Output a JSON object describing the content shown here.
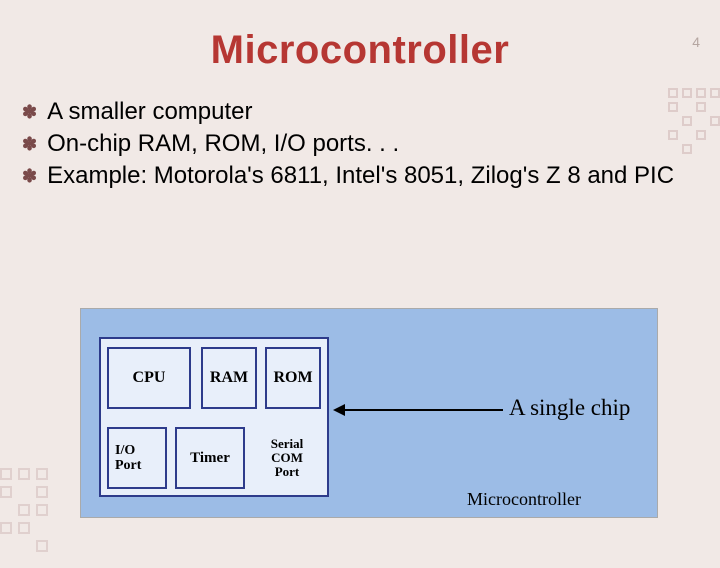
{
  "page_number": "4",
  "title": "Microcontroller",
  "bullets": [
    "A smaller computer",
    "On-chip RAM, ROM, I/O ports. . .",
    "Example: Motorola's 6811, Intel's 8051, Zilog's Z 8 and PIC"
  ],
  "diagram": {
    "cells": {
      "cpu": "CPU",
      "ram": "RAM",
      "rom": "ROM",
      "io": "I/O\nPort",
      "timer": "Timer",
      "serial": "Serial\nCOM\nPort"
    },
    "arrow_label": "A single  chip",
    "caption": "Microcontroller"
  }
}
